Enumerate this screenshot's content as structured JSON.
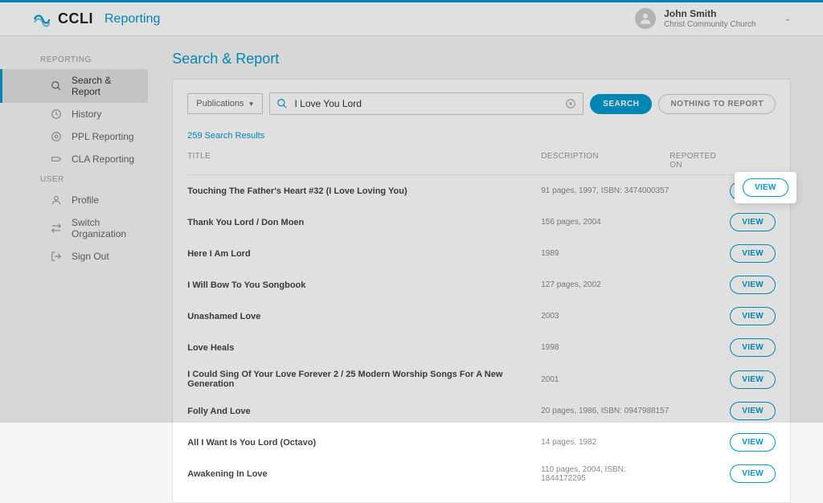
{
  "header": {
    "brand_primary": "CCLI",
    "brand_secondary": "Reporting",
    "user_name": "John Smith",
    "user_org": "Christ Community Church"
  },
  "sidebar": {
    "section1_label": "REPORTING",
    "section2_label": "USER",
    "items_reporting": [
      {
        "label": "Search & Report",
        "icon": "search-icon",
        "active": true
      },
      {
        "label": "History",
        "icon": "history-icon",
        "active": false
      },
      {
        "label": "PPL Reporting",
        "icon": "ppl-icon",
        "active": false
      },
      {
        "label": "CLA Reporting",
        "icon": "cla-icon",
        "active": false
      }
    ],
    "items_user": [
      {
        "label": "Profile",
        "icon": "profile-icon"
      },
      {
        "label": "Switch Organization",
        "icon": "switch-icon"
      },
      {
        "label": "Sign Out",
        "icon": "signout-icon"
      }
    ]
  },
  "page": {
    "title": "Search & Report",
    "filter_label": "Publications",
    "search_value": "I Love You Lord",
    "search_btn": "SEARCH",
    "nothing_btn": "NOTHING TO REPORT",
    "results_count": "259 Search Results",
    "columns": {
      "title": "TITLE",
      "description": "DESCRIPTION",
      "reported": "REPORTED ON"
    },
    "view_label": "VIEW",
    "results": [
      {
        "title": "Touching The Father's Heart #32 (I Love Loving You)",
        "description": "91 pages, 1997, ISBN: 3474000357"
      },
      {
        "title": "Thank You Lord / Don Moen",
        "description": "156 pages, 2004"
      },
      {
        "title": "Here I Am Lord",
        "description": "1989"
      },
      {
        "title": "I Will Bow To You Songbook",
        "description": "127 pages, 2002"
      },
      {
        "title": "Unashamed Love",
        "description": "2003"
      },
      {
        "title": "Love Heals",
        "description": "1998"
      },
      {
        "title": "I Could Sing Of Your Love Forever 2 / 25 Modern Worship Songs For A New Generation",
        "description": "2001"
      },
      {
        "title": "Folly And Love",
        "description": "20 pages, 1986, ISBN: 0947988157"
      },
      {
        "title": "All I Want Is You Lord (Octavo)",
        "description": "14 pages, 1982"
      },
      {
        "title": "Awakening In Love",
        "description": "110 pages, 2004, ISBN: 1844172295"
      }
    ]
  }
}
